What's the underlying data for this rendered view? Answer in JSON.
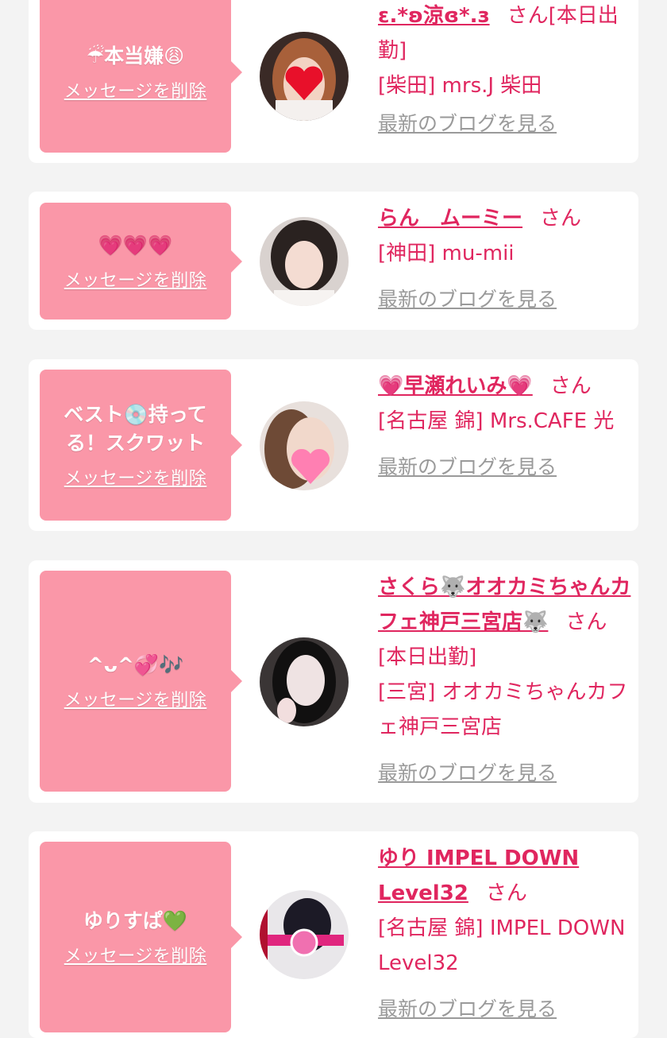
{
  "colors": {
    "accent": "#e0265f",
    "bubble": "#fa97a8",
    "background": "#f3f3f3",
    "link_gray": "#9a9a9a"
  },
  "delete_label": "メッセージを削除",
  "blog_label": "最新のブログを見る",
  "honorific": "さん",
  "cards": [
    {
      "message": "☔本当嫌😩",
      "name": "ε.*ʚ涼ɞ*.з",
      "badge": "[本日出勤]",
      "shop": "[柴田] mrs.J 柴田",
      "avatar_icon": "heart-sticker-avatar"
    },
    {
      "message": "💗💗💗",
      "name": "らん　ムーミー",
      "badge": "",
      "shop": "[神田] mu-mii",
      "avatar_icon": "girl-photo-avatar"
    },
    {
      "message": "ベスト💿持ってる！スクワット",
      "name": "💗早瀬れいみ💗",
      "badge": "",
      "shop": "[名古屋 錦] Mrs.CAFE 光",
      "avatar_icon": "heart-sticker-avatar"
    },
    {
      "message": "^ᴗ^💞🎶",
      "name": "さくら🐺オオカミちゃんカフェ神戸三宮店🐺",
      "badge": "[本日出勤]",
      "shop": "[三宮] オオカミちゃんカフェ神戸三宮店",
      "avatar_icon": "girl-photo-avatar"
    },
    {
      "message": "ゆりすぱ💚",
      "name": "ゆり IMPEL DOWN Level32",
      "badge": "",
      "shop": "[名古屋 錦] IMPEL DOWN Level32",
      "avatar_icon": "logo-photo-avatar"
    }
  ]
}
